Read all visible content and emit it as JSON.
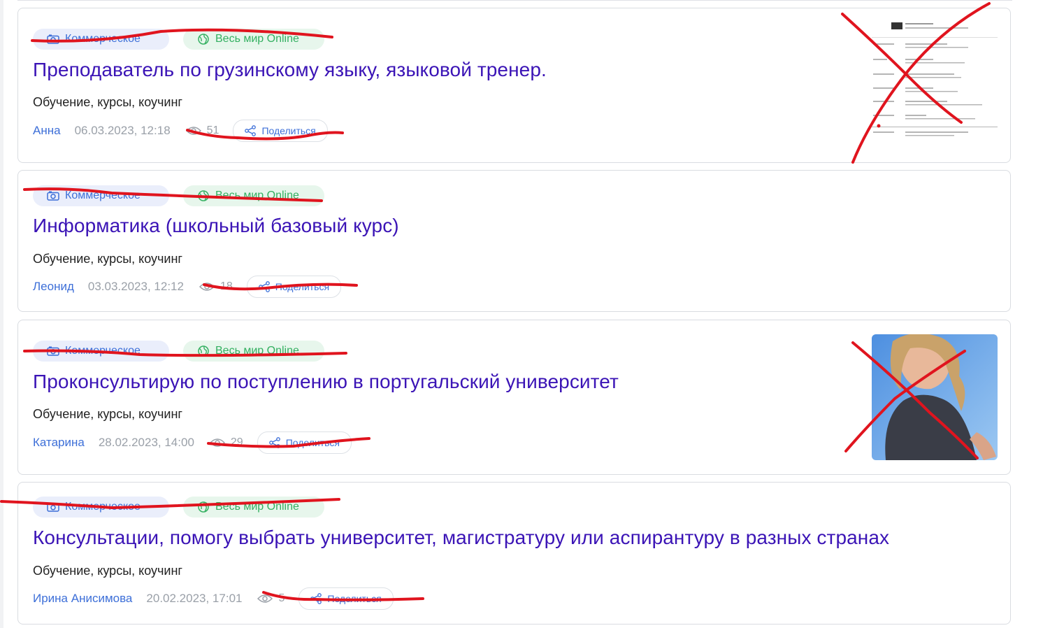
{
  "listings": [
    {
      "tag_commercial": "Коммерческое",
      "tag_world": "Весь мир Online",
      "title": "Преподаватель по грузинскому языку, языковой тренер.",
      "category": "Обучение, курсы, коучинг",
      "author": "Анна",
      "date": "06.03.2023, 12:18",
      "views": "51",
      "share_label": "Поделиться",
      "thumbnail": "resume-document"
    },
    {
      "tag_commercial": "Коммерческое",
      "tag_world": "Весь мир Online",
      "title": "Информатика (школьный базовый курс)",
      "category": "Обучение, курсы, коучинг",
      "author": "Леонид",
      "date": "03.03.2023, 12:12",
      "views": "18",
      "share_label": "Поделиться"
    },
    {
      "tag_commercial": "Коммерческое",
      "tag_world": "Весь мир Online",
      "title": "Проконсультирую по поступлению в португальский университет",
      "category": "Обучение, курсы, коучинг",
      "author": "Катарина",
      "date": "28.02.2023, 14:00",
      "views": "29",
      "share_label": "Поделиться",
      "thumbnail": "person-photo"
    },
    {
      "tag_commercial": "Коммерческое",
      "tag_world": "Весь мир Online",
      "title": "Консультации, помогу выбрать университет, магистратуру или аспирантуру в разных странах",
      "category": "Обучение, курсы, коучинг",
      "author": "Ирина Анисимова",
      "date": "20.02.2023, 17:01",
      "views": "5",
      "share_label": "Поделиться"
    }
  ],
  "colors": {
    "title": "#3b14b6",
    "link": "#3d6fd8",
    "tag_commercial_bg": "#eaeefb",
    "tag_world_bg": "#e7f6ec",
    "tag_world_text": "#34b061",
    "annotation_red": "#e0141e"
  },
  "icons": {
    "commercial": "camera-icon",
    "world": "globe-icon",
    "views": "eye-icon",
    "share": "share-icon"
  }
}
